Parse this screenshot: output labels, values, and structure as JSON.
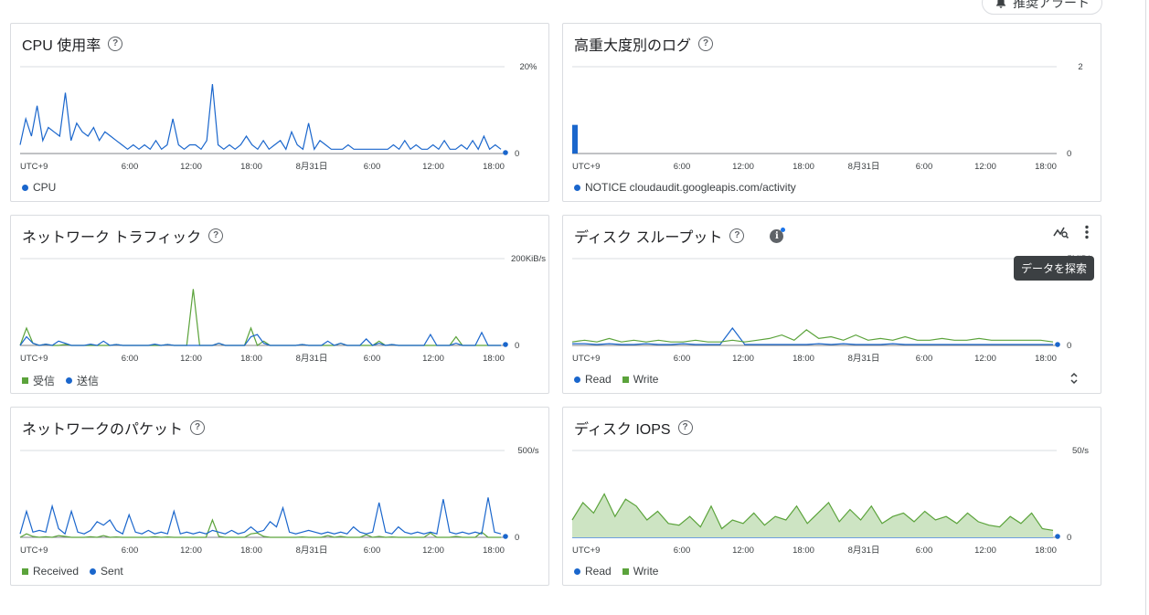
{
  "top": {
    "recommend_alerts": "推奨アラート"
  },
  "tooltip": "データを探索",
  "x_ticks": [
    "UTC+9",
    "6:00",
    "12:00",
    "18:00",
    "8月31日",
    "6:00",
    "12:00",
    "18:00"
  ],
  "colors": {
    "blue": "#1a66cc",
    "green": "#5ba33b"
  },
  "cards": [
    {
      "id": "cpu",
      "title": "CPU 使用率",
      "y_max": "20%",
      "y_min": "0",
      "legend": [
        {
          "shape": "dot",
          "label": "CPU"
        }
      ]
    },
    {
      "id": "logs",
      "title": "高重大度別のログ",
      "y_max": "2",
      "y_min": "0",
      "legend": [
        {
          "shape": "dot",
          "label": "NOTICE cloudaudit.googleapis.com/activity"
        }
      ]
    },
    {
      "id": "net",
      "title": "ネットワーク トラフィック",
      "y_max": "200KiB/s",
      "y_min": "0",
      "legend": [
        {
          "shape": "sq",
          "label": "受信"
        },
        {
          "shape": "dot",
          "label": "送信"
        }
      ]
    },
    {
      "id": "disk",
      "title": "ディスク スループット",
      "y_max": "5MiB/s",
      "y_min": "0",
      "legend": [
        {
          "shape": "dot",
          "label": "Read"
        },
        {
          "shape": "sq",
          "label": "Write"
        }
      ]
    },
    {
      "id": "pkt",
      "title": "ネットワークのパケット",
      "y_max": "500/s",
      "y_min": "0",
      "legend": [
        {
          "shape": "sq",
          "label": "Received"
        },
        {
          "shape": "dot",
          "label": "Sent"
        }
      ]
    },
    {
      "id": "iops",
      "title": "ディスク IOPS",
      "y_max": "50/s",
      "y_min": "0",
      "legend": [
        {
          "shape": "dot",
          "label": "Read"
        },
        {
          "shape": "sq",
          "label": "Write"
        }
      ]
    }
  ],
  "chart_data": [
    {
      "type": "line",
      "title": "CPU 使用率",
      "ylim": [
        0,
        20
      ],
      "series": [
        {
          "name": "CPU",
          "values": [
            2,
            8,
            4,
            11,
            3,
            6,
            5,
            4,
            14,
            3,
            7,
            5,
            4,
            6,
            3,
            5,
            4,
            3,
            2,
            1,
            2,
            1,
            2,
            1,
            3,
            1,
            2,
            8,
            2,
            1,
            2,
            2,
            1,
            3,
            16,
            2,
            1,
            2,
            1,
            2,
            4,
            2,
            1,
            3,
            1,
            2,
            3,
            1,
            5,
            2,
            1,
            7,
            1,
            3,
            2,
            1,
            1,
            1,
            2,
            1,
            1,
            1,
            1,
            1,
            1,
            1,
            2,
            1,
            3,
            1,
            2,
            1,
            1,
            2,
            1,
            3,
            1,
            1,
            2,
            1,
            3,
            1,
            4,
            1,
            2,
            1
          ]
        }
      ]
    },
    {
      "type": "bar",
      "title": "高重大度別のログ",
      "ylim": [
        0,
        2
      ],
      "series": [
        {
          "name": "NOTICE cloudaudit.googleapis.com/activity",
          "values": [
            0.66
          ]
        }
      ]
    },
    {
      "type": "line",
      "title": "ネットワーク トラフィック",
      "ylim": [
        0,
        200
      ],
      "series": [
        {
          "name": "受信",
          "values": [
            0,
            40,
            5,
            0,
            3,
            0,
            0,
            2,
            0,
            0,
            0,
            0,
            0,
            0,
            0,
            2,
            0,
            0,
            0,
            0,
            0,
            0,
            0,
            2,
            0,
            0,
            0,
            130,
            0,
            0,
            0,
            5,
            0,
            0,
            0,
            0,
            40,
            0,
            10,
            0,
            0,
            0,
            0,
            0,
            2,
            0,
            0,
            0,
            0,
            0,
            5,
            0,
            0,
            0,
            0,
            0,
            10,
            0,
            2,
            0,
            0,
            0,
            0,
            0,
            0,
            0,
            0,
            0,
            20,
            0,
            0,
            0,
            0,
            0,
            0,
            0
          ]
        },
        {
          "name": "送信",
          "values": [
            0,
            20,
            5,
            0,
            3,
            0,
            10,
            5,
            0,
            0,
            0,
            3,
            0,
            10,
            0,
            2,
            0,
            0,
            0,
            0,
            0,
            3,
            0,
            2,
            0,
            0,
            0,
            0,
            0,
            0,
            0,
            5,
            0,
            0,
            0,
            0,
            20,
            25,
            5,
            0,
            0,
            0,
            0,
            0,
            2,
            0,
            0,
            0,
            10,
            0,
            5,
            0,
            0,
            0,
            15,
            0,
            5,
            0,
            2,
            0,
            0,
            0,
            0,
            0,
            25,
            0,
            0,
            0,
            5,
            0,
            0,
            0,
            30,
            0,
            0,
            0
          ]
        }
      ]
    },
    {
      "type": "line",
      "title": "ディスク スループット",
      "ylim": [
        0,
        5
      ],
      "series": [
        {
          "name": "Read",
          "values": [
            0.1,
            0.1,
            0.05,
            0.1,
            0.05,
            0.05,
            0.1,
            0.05,
            0.05,
            0.1,
            0.05,
            0.05,
            0.05,
            1,
            0.05,
            0.05,
            0.05,
            0.05,
            0.05,
            0.05,
            0.1,
            0.05,
            0.1,
            0.05,
            0.05,
            0.05,
            0.1,
            0.05,
            0.05,
            0.05,
            0.05,
            0.05,
            0.05,
            0.05,
            0.05,
            0.05,
            0.05,
            0.05,
            0.05,
            0.05
          ]
        },
        {
          "name": "Write",
          "values": [
            0.2,
            0.3,
            0.2,
            0.4,
            0.2,
            0.3,
            0.2,
            0.3,
            0.2,
            0.2,
            0.3,
            0.2,
            0.2,
            0.3,
            0.2,
            0.3,
            0.4,
            0.6,
            0.3,
            0.9,
            0.4,
            0.5,
            0.3,
            0.6,
            0.3,
            0.4,
            0.3,
            0.5,
            0.3,
            0.3,
            0.4,
            0.3,
            0.3,
            0.4,
            0.3,
            0.3,
            0.3,
            0.3,
            0.3,
            0.2
          ]
        }
      ]
    },
    {
      "type": "line",
      "title": "ネットワークのパケット",
      "ylim": [
        0,
        500
      ],
      "series": [
        {
          "name": "Received",
          "values": [
            0,
            20,
            5,
            0,
            3,
            0,
            10,
            5,
            0,
            0,
            0,
            3,
            0,
            10,
            0,
            2,
            0,
            0,
            0,
            0,
            0,
            3,
            0,
            2,
            0,
            0,
            0,
            0,
            0,
            0,
            100,
            5,
            0,
            0,
            0,
            0,
            20,
            25,
            5,
            0,
            0,
            0,
            0,
            0,
            2,
            0,
            0,
            0,
            10,
            0,
            5,
            0,
            0,
            0,
            15,
            0,
            5,
            0,
            2,
            0,
            0,
            0,
            0,
            0,
            25,
            0,
            0,
            0,
            5,
            0,
            0,
            0,
            30,
            0,
            0,
            0
          ]
        },
        {
          "name": "Sent",
          "values": [
            20,
            150,
            30,
            40,
            30,
            180,
            50,
            20,
            150,
            30,
            20,
            40,
            90,
            70,
            100,
            40,
            20,
            130,
            30,
            20,
            40,
            20,
            30,
            20,
            150,
            20,
            30,
            20,
            30,
            20,
            40,
            30,
            20,
            40,
            20,
            30,
            60,
            30,
            40,
            90,
            60,
            170,
            30,
            20,
            30,
            40,
            30,
            20,
            30,
            20,
            30,
            20,
            60,
            30,
            20,
            30,
            200,
            30,
            20,
            60,
            30,
            20,
            30,
            20,
            30,
            20,
            220,
            30,
            20,
            30,
            20,
            30,
            20,
            230,
            30,
            20
          ]
        }
      ]
    },
    {
      "type": "area",
      "title": "ディスク IOPS",
      "ylim": [
        0,
        50
      ],
      "series": [
        {
          "name": "Read",
          "values": [
            0,
            0,
            0,
            0,
            0,
            0,
            0,
            0,
            0,
            0,
            0,
            0,
            0,
            0,
            0,
            0,
            0,
            0,
            0,
            0,
            0,
            0,
            0,
            0,
            0,
            0,
            0,
            0,
            0,
            0,
            0,
            0,
            0,
            0,
            0,
            0,
            0,
            0,
            0,
            0,
            0,
            0,
            0,
            0,
            0,
            0
          ]
        },
        {
          "name": "Write",
          "values": [
            10,
            20,
            14,
            25,
            12,
            22,
            18,
            10,
            15,
            8,
            7,
            12,
            6,
            18,
            5,
            10,
            8,
            14,
            7,
            12,
            10,
            18,
            8,
            14,
            20,
            9,
            16,
            10,
            18,
            8,
            12,
            14,
            9,
            15,
            10,
            12,
            8,
            14,
            9,
            7,
            6,
            12,
            8,
            14,
            5,
            4
          ]
        }
      ]
    }
  ]
}
